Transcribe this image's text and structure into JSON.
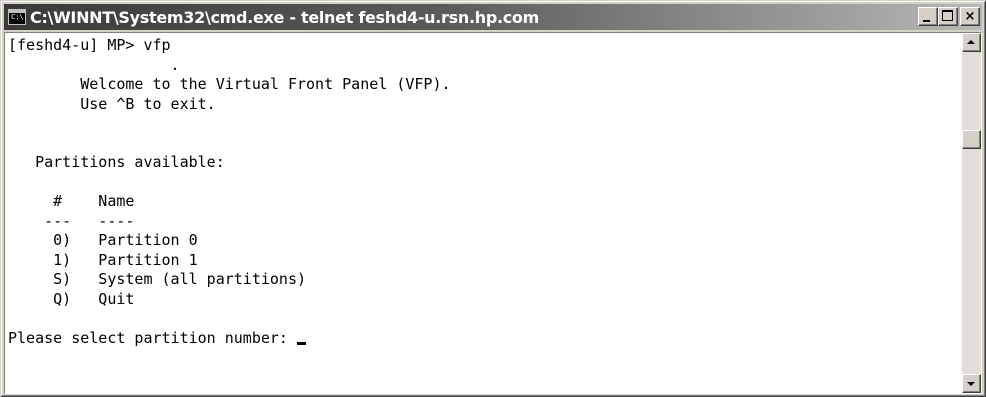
{
  "window": {
    "title": "C:\\WINNT\\System32\\cmd.exe - telnet feshd4-u.rsn.hp.com",
    "icon": "console-icon",
    "icon_text": "C:\\"
  },
  "title_buttons": {
    "minimize": "minimize-icon",
    "maximize": "maximize-icon",
    "close": "×"
  },
  "console": {
    "lines": [
      "[feshd4-u] MP> vfp",
      "                  .",
      "        Welcome to the Virtual Front Panel (VFP).",
      "        Use ^B to exit.",
      "",
      "",
      "   Partitions available:",
      "",
      "     #    Name",
      "    ---   ----",
      "     0)   Partition 0",
      "     1)   Partition 1",
      "     S)   System (all partitions)",
      "     Q)   Quit",
      "",
      "Please select partition number: "
    ]
  },
  "scrollbar": {
    "up": "scroll-up-arrow",
    "down": "scroll-down-arrow"
  }
}
